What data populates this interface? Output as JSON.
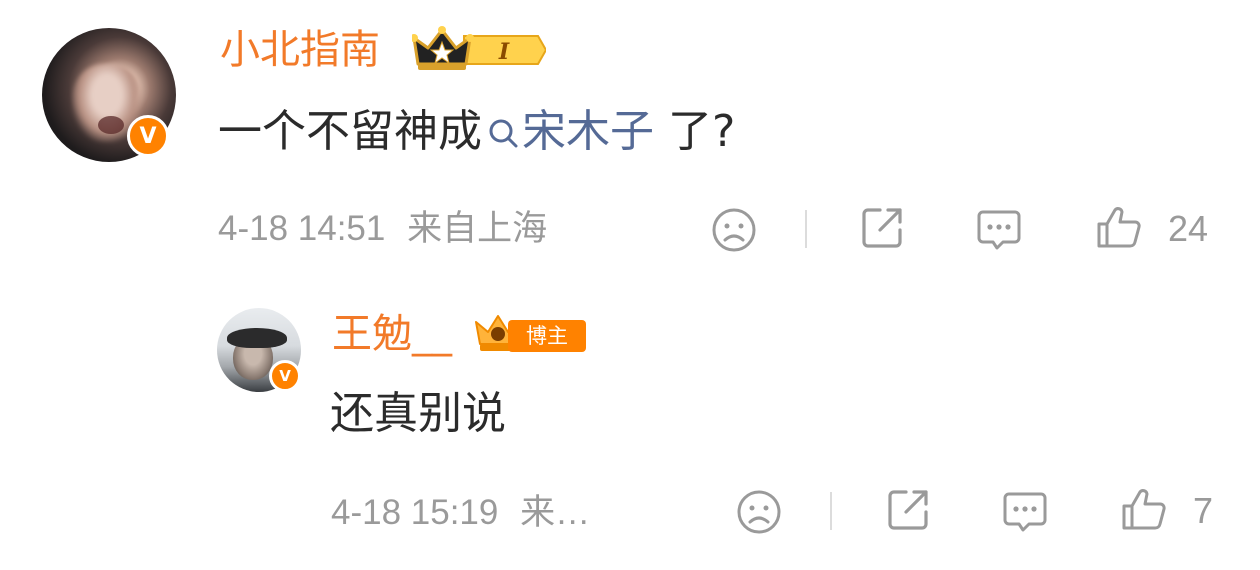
{
  "comments": [
    {
      "username": "小北指南",
      "crown_level": "I",
      "text_before": "一个不留神成",
      "topic": "宋木子",
      "text_after": " 了?",
      "timestamp": "4-18 14:51",
      "location": "来自上海",
      "like_count": "24",
      "verified_mark": "V"
    },
    {
      "username": "王勉__",
      "badge_label": "博主",
      "text": "还真别说",
      "timestamp": "4-18 15:19",
      "location": "来…",
      "like_count": "7",
      "verified_mark": "V"
    }
  ],
  "icons": [
    "sad-face-icon",
    "share-icon",
    "comment-icon",
    "thumbs-up-icon",
    "search-icon",
    "crown-icon",
    "verified-icon"
  ],
  "colors": {
    "username": "#f27a29",
    "topic_link": "#556a96",
    "meta": "#9a9a9a",
    "verified": "#ff8200"
  }
}
